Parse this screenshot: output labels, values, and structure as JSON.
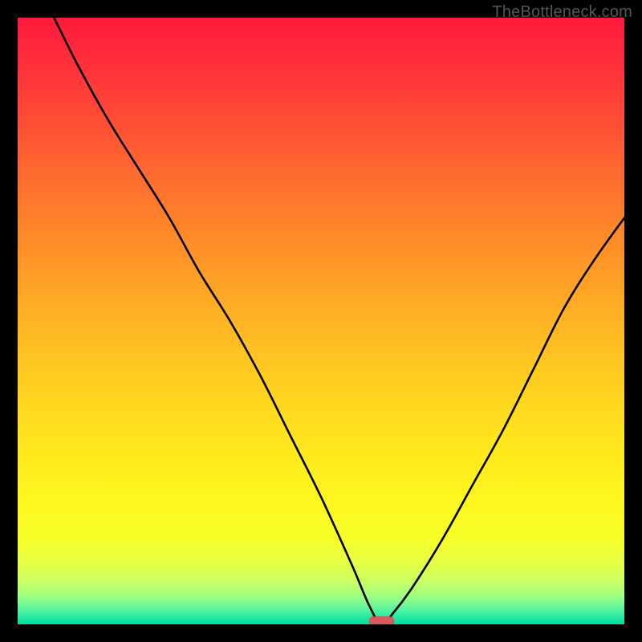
{
  "watermark": "TheBottleneck.com",
  "chart_data": {
    "type": "line",
    "title": "",
    "xlabel": "",
    "ylabel": "",
    "xlim": [
      0,
      100
    ],
    "ylim": [
      0,
      100
    ],
    "background_gradient": {
      "direction": "vertical",
      "stops": [
        {
          "pos": 0,
          "color": "#ff1a3f"
        },
        {
          "pos": 50,
          "color": "#ffc122"
        },
        {
          "pos": 80,
          "color": "#fff71f"
        },
        {
          "pos": 100,
          "color": "#00df9f"
        }
      ]
    },
    "series": [
      {
        "name": "curve",
        "color": "#000000",
        "x": [
          6,
          10,
          15,
          20,
          25,
          30,
          35,
          40,
          45,
          50,
          55,
          58,
          60,
          62,
          65,
          70,
          75,
          80,
          85,
          90,
          95,
          100
        ],
        "y": [
          100,
          92,
          83,
          75,
          67,
          58,
          50,
          41,
          31,
          21,
          10,
          3,
          0,
          2,
          6,
          14,
          23,
          32,
          42,
          52,
          60,
          67
        ]
      }
    ],
    "marker": {
      "x_center": 60,
      "width": 4,
      "y": 0.5,
      "color": "#d85a5a"
    }
  }
}
